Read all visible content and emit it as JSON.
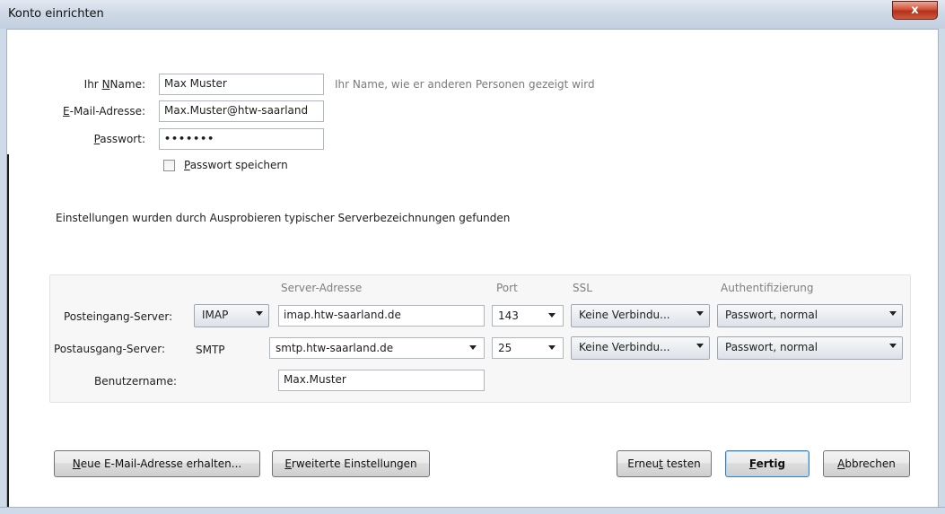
{
  "window": {
    "title": "Konto einrichten",
    "close_label": "x"
  },
  "form": {
    "name_label": "Name:",
    "name_label_prefix": "Ihr ",
    "name_value": "Max Muster",
    "name_hint": "Ihr Name, wie er anderen Personen gezeigt wird",
    "email_label_first": "E",
    "email_label_rest": "-Mail-Adresse:",
    "email_value": "Max.Muster@htw-saarland",
    "password_label_first": "P",
    "password_label_rest": "asswort:",
    "password_value": "•••••••",
    "save_password_first": "P",
    "save_password_rest": "asswort speichern",
    "save_password_checked": false
  },
  "status_message": "Einstellungen wurden durch Ausprobieren typischer Serverbezeichnungen gefunden",
  "server": {
    "headers": {
      "address": "Server-Adresse",
      "port": "Port",
      "ssl": "SSL",
      "auth": "Authentifizierung"
    },
    "incoming": {
      "label": "Posteingang-Server:",
      "protocol": "IMAP",
      "address": "imap.htw-saarland.de",
      "port": "143",
      "ssl": "Keine Verbindu...",
      "auth": "Passwort, normal"
    },
    "outgoing": {
      "label": "Postausgang-Server:",
      "protocol": "SMTP",
      "address": "smtp.htw-saarland.de",
      "port": "25",
      "ssl": "Keine Verbindu...",
      "auth": "Passwort, normal"
    },
    "username": {
      "label": "Benutzername:",
      "value": "Max.Muster"
    }
  },
  "buttons": {
    "new_address_first": "N",
    "new_address_rest": "eue E-Mail-Adresse erhalten...",
    "advanced_first": "E",
    "advanced_rest": "rweiterte Einstellungen",
    "retest_pre": "Erneu",
    "retest_u": "t",
    "retest_post": " testen",
    "done_first": "F",
    "done_rest": "ertig",
    "cancel_first": "A",
    "cancel_rest": "bbrechen"
  }
}
